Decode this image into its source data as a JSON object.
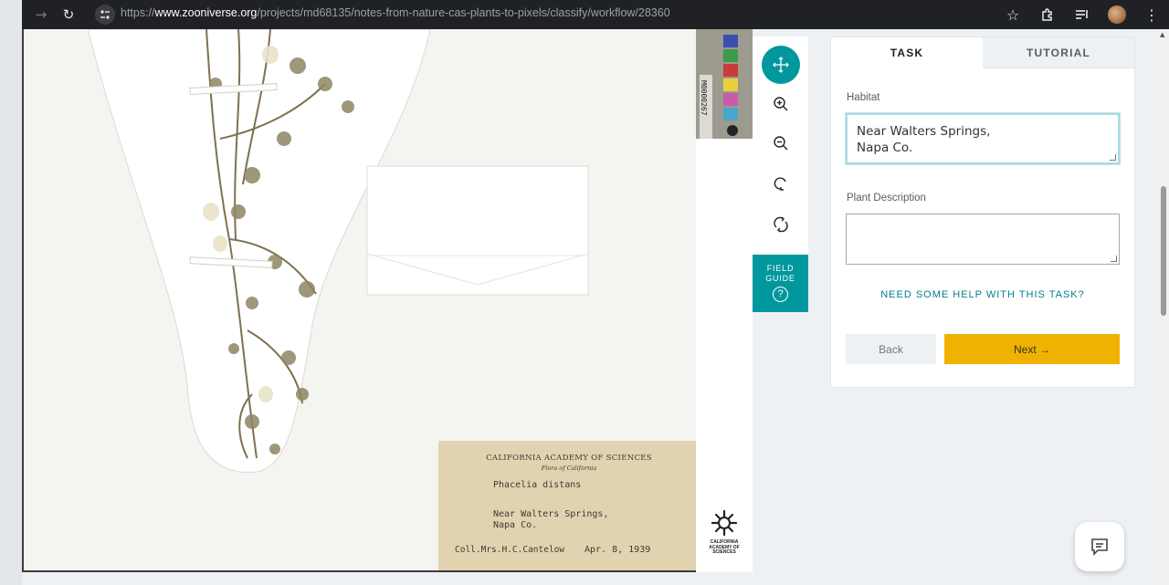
{
  "browser": {
    "url_prefix": "https://",
    "url_domain": "www.zooniverse.org",
    "url_path": "/projects/md68135/notes-from-nature-cas-plants-to-pixels/classify/workflow/28360",
    "back_icon": "back-arrow-icon",
    "forward_icon": "forward-arrow-icon",
    "reload_icon": "reload-icon"
  },
  "specimen": {
    "barcode": "M0000267",
    "label": {
      "institution": "CALIFORNIA ACADEMY OF SCIENCES",
      "flora": "Flora of California",
      "species": "Phacelia distans",
      "locality_line1": "Near Walters Springs,",
      "locality_line2": "Napa Co.",
      "collector": "Coll.Mrs.H.C.Cantelow",
      "date": "Apr. 8, 1939"
    },
    "logo_text": "CALIFORNIA ACADEMY OF SCIENCES",
    "swatch_colors": [
      "#3b4fb0",
      "#3d9a46",
      "#c83b3b",
      "#e8d23a",
      "#c85ca8",
      "#4aa6c9",
      "#e8e8e8"
    ]
  },
  "toolbar": {
    "tools": [
      "move-icon",
      "zoom-in-icon",
      "zoom-out-icon",
      "rotate-icon",
      "reset-icon"
    ],
    "field_guide_line1": "FIELD",
    "field_guide_line2": "GUIDE",
    "field_guide_q": "?"
  },
  "panel": {
    "tab_task": "TASK",
    "tab_tutorial": "TUTORIAL",
    "habitat_label": "Habitat",
    "habitat_line1": "Near Walters Springs,",
    "habitat_line2": "Napa Co.",
    "description_label": "Plant Description",
    "description_value": "",
    "help_text": "NEED SOME HELP WITH THIS TASK?",
    "back_label": "Back",
    "next_label": "Next →"
  },
  "colors": {
    "teal": "#00979d",
    "next_yellow": "#f0b200"
  }
}
